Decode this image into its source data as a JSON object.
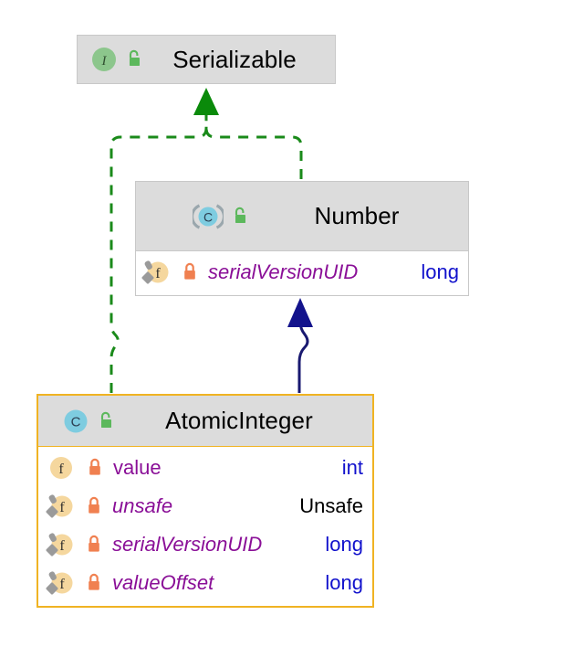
{
  "diagram": {
    "title": "UML class hierarchy diagram",
    "background_color": "#ffffff",
    "selected_node": "AtomicInteger"
  },
  "colors": {
    "header_background": "#dcdcdc",
    "body_background": "#ffffff",
    "node_border": "#c8c8c8",
    "selected_border": "#f0b323",
    "member_name": "#8a0f97",
    "member_type": "#1111cc",
    "member_type_unresolved": "#000000",
    "realization_arrow": "#1a8a1a",
    "generalization_arrow": "#191970",
    "interface_icon": "#8cc68c",
    "class_icon": "#7ecce0",
    "field_icon": "#f5d79e",
    "public_lock": "#5cb85c",
    "private_lock": "#f08050",
    "static_overlay": "#9a9a9a"
  },
  "nodes": [
    {
      "id": "serializable",
      "name": "Serializable",
      "kind": "interface",
      "kind_icon": "interface-icon",
      "visibility": "public",
      "visibility_icon": "unlocked-padlock-icon",
      "selected": false,
      "members": []
    },
    {
      "id": "number",
      "name": "Number",
      "kind": "abstract-class",
      "kind_icon": "abstract-class-icon",
      "visibility": "public",
      "visibility_icon": "unlocked-padlock-icon",
      "selected": false,
      "members": [
        {
          "name": "serialVersionUID",
          "type": "long",
          "visibility": "private",
          "visibility_icon": "locked-padlock-icon",
          "member_icon": "static-field-icon",
          "static": true,
          "italic": true,
          "type_resolved": true
        }
      ]
    },
    {
      "id": "atomicinteger",
      "name": "AtomicInteger",
      "kind": "class",
      "kind_icon": "class-icon",
      "visibility": "public",
      "visibility_icon": "unlocked-padlock-icon",
      "selected": true,
      "members": [
        {
          "name": "value",
          "type": "int",
          "visibility": "private",
          "visibility_icon": "locked-padlock-icon",
          "member_icon": "field-icon",
          "static": false,
          "italic": false,
          "type_resolved": true
        },
        {
          "name": "unsafe",
          "type": "Unsafe",
          "visibility": "private",
          "visibility_icon": "locked-padlock-icon",
          "member_icon": "static-field-icon",
          "static": true,
          "italic": true,
          "type_resolved": false
        },
        {
          "name": "serialVersionUID",
          "type": "long",
          "visibility": "private",
          "visibility_icon": "locked-padlock-icon",
          "member_icon": "static-field-icon",
          "static": true,
          "italic": true,
          "type_resolved": true
        },
        {
          "name": "valueOffset",
          "type": "long",
          "visibility": "private",
          "visibility_icon": "locked-padlock-icon",
          "member_icon": "static-field-icon",
          "static": true,
          "italic": true,
          "type_resolved": true
        }
      ]
    }
  ],
  "edges": [
    {
      "id": "number-implements-serializable",
      "from": "Number",
      "to": "Serializable",
      "relation": "realization",
      "line_style": "dashed",
      "arrow": "hollow-triangle-filled-green",
      "color": "#1a8a1a"
    },
    {
      "id": "atomicinteger-implements-serializable",
      "from": "AtomicInteger",
      "to": "Serializable",
      "relation": "realization",
      "line_style": "dashed",
      "arrow": "hollow-triangle-filled-green",
      "color": "#1a8a1a"
    },
    {
      "id": "atomicinteger-extends-number",
      "from": "AtomicInteger",
      "to": "Number",
      "relation": "generalization",
      "line_style": "solid",
      "arrow": "filled-triangle-navy",
      "color": "#191970"
    }
  ]
}
